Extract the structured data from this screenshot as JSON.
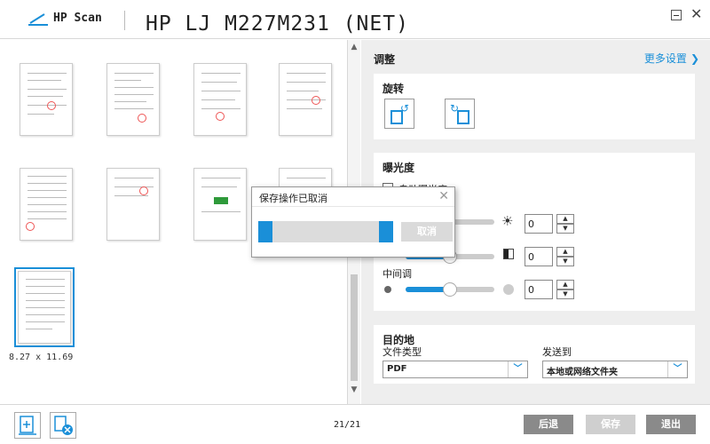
{
  "app": {
    "name": "HP Scan",
    "device": "HP LJ M227M231 (NET)"
  },
  "preview": {
    "page_size": "8.27  x  11.69"
  },
  "settings": {
    "title": "调整",
    "more_settings": "更多设置",
    "rotate": {
      "title": "旋转"
    },
    "exposure": {
      "title": "曝光度",
      "auto_label": "自动曝光度",
      "brightness": "0",
      "contrast": "0",
      "midtone_label": "中间调",
      "midtone": "0"
    },
    "destination": {
      "title": "目的地",
      "file_type_label": "文件类型",
      "file_type_value": "PDF",
      "send_to_label": "发送到",
      "send_to_value": "本地或网络文件夹"
    }
  },
  "dialog": {
    "title": "保存操作已取消",
    "cancel_label": "取消"
  },
  "bottom": {
    "page_count": "21/21",
    "back_label": "后退",
    "save_label": "保存",
    "exit_label": "退出"
  },
  "colors": {
    "accent": "#1a8fd8",
    "button_dark": "#8a8a8a",
    "button_disabled": "#cfcfcf"
  }
}
